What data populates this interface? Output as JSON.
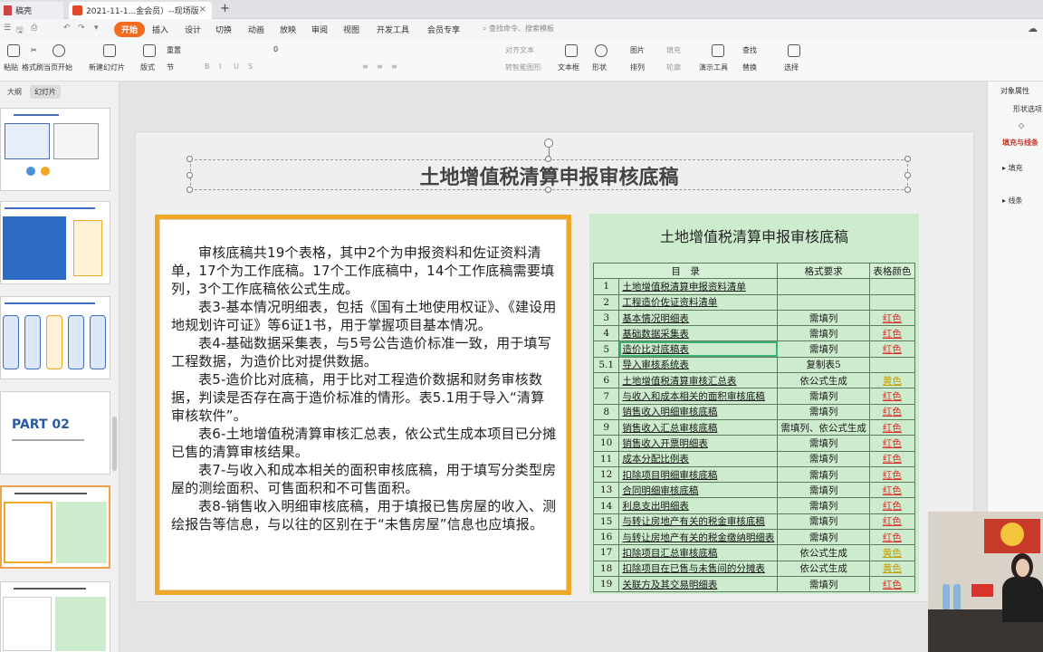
{
  "tabs": [
    {
      "label": "稿壳"
    },
    {
      "label": "2021-11-1...金会员）--现场版"
    }
  ],
  "menu": {
    "items": [
      "开始",
      "插入",
      "设计",
      "切换",
      "动画",
      "放映",
      "审阅",
      "视图",
      "开发工具",
      "会员专享"
    ],
    "search": "查找命令、搜索模板"
  },
  "ribbon": {
    "paste": "粘贴",
    "format_painter": "格式刷",
    "from_current": "当页开始",
    "new_slide": "新建幻灯片",
    "layout": "版式",
    "section": "节",
    "reset": "重置",
    "font_size": "0",
    "align_text": "对齐文本",
    "smart_graphic": "转智能图形",
    "textbox": "文本框",
    "shape": "形状",
    "arrange": "排列",
    "picture": "图片",
    "fill": "填充",
    "outline": "轮廓",
    "present_tools": "演示工具",
    "find": "查找",
    "replace": "替换",
    "select": "选择"
  },
  "leftpane": {
    "outline_tab": "大纲",
    "slides_tab": "幻灯片",
    "part_label": "PART 02"
  },
  "slide": {
    "title": "土地增值税清算申报审核底稿",
    "paragraphs": [
      "审核底稿共19个表格，其中2个为申报资料和佐证资料清单，17个为工作底稿。17个工作底稿中，14个工作底稿需要填列，3个工作底稿依公式生成。",
      "表3-基本情况明细表，包括《国有土地使用权证》、《建设用地规划许可证》等6证1书，用于掌握项目基本情况。",
      "表4-基础数据采集表，与5号公告造价标准一致，用于填写工程数据，为造价比对提供数据。",
      "表5-造价比对底稿，用于比对工程造价数据和财务审核数据，判读是否存在高于造价标准的情形。表5.1用于导入“清算审核软件”。",
      "表6-土地增值税清算审核汇总表，依公式生成本项目已分摊已售的清算审核结果。",
      "表7-与收入和成本相关的面积审核底稿，用于填写分类型房屋的测绘面积、可售面积和不可售面积。",
      "表8-销售收入明细审核底稿，用于填报已售房屋的收入、测绘报告等信息，与以往的区别在于“未售房屋”信息也应填报。"
    ],
    "table_title": "土地增值税清算申报审核底稿",
    "headers": [
      "目　录",
      "格式要求",
      "表格颜色"
    ],
    "rows": [
      {
        "no": "1",
        "name": "土地增值税清算申报资料清单",
        "fmt": "",
        "color": ""
      },
      {
        "no": "2",
        "name": "工程造价佐证资料清单",
        "fmt": "",
        "color": ""
      },
      {
        "no": "3",
        "name": "基本情况明细表",
        "fmt": "需填列",
        "color": "红色"
      },
      {
        "no": "4",
        "name": "基础数据采集表",
        "fmt": "需填列",
        "color": "红色"
      },
      {
        "no": "5",
        "name": "造价比对底稿表",
        "fmt": "需填列",
        "color": "红色"
      },
      {
        "no": "5.1",
        "name": "导入审核系统表",
        "fmt": "复制表5",
        "color": ""
      },
      {
        "no": "6",
        "name": "土地增值税清算审核汇总表",
        "fmt": "依公式生成",
        "color": "黄色"
      },
      {
        "no": "7",
        "name": "与收入和成本相关的面积审核底稿",
        "fmt": "需填列",
        "color": "红色"
      },
      {
        "no": "8",
        "name": "销售收入明细审核底稿",
        "fmt": "需填列",
        "color": "红色"
      },
      {
        "no": "9",
        "name": "销售收入汇总审核底稿",
        "fmt": "需填列、依公式生成",
        "color": "红色"
      },
      {
        "no": "10",
        "name": "销售收入开票明细表",
        "fmt": "需填列",
        "color": "红色"
      },
      {
        "no": "11",
        "name": "成本分配比例表",
        "fmt": "需填列",
        "color": "红色"
      },
      {
        "no": "12",
        "name": "扣除项目明细审核底稿",
        "fmt": "需填列",
        "color": "红色"
      },
      {
        "no": "13",
        "name": "合同明细审核底稿",
        "fmt": "需填列",
        "color": "红色"
      },
      {
        "no": "14",
        "name": "利息支出明细表",
        "fmt": "需填列",
        "color": "红色"
      },
      {
        "no": "15",
        "name": "与转让房地产有关的税金审核底稿",
        "fmt": "需填列",
        "color": "红色"
      },
      {
        "no": "16",
        "name": "与转让房地产有关的税金缴纳明细表",
        "fmt": "需填列",
        "color": "红色"
      },
      {
        "no": "17",
        "name": "扣除项目汇总审核底稿",
        "fmt": "依公式生成",
        "color": "黄色"
      },
      {
        "no": "18",
        "name": "扣除项目在已售与未售间的分摊表",
        "fmt": "依公式生成",
        "color": "黄色"
      },
      {
        "no": "19",
        "name": "关联方及其交易明细表",
        "fmt": "需填列",
        "color": "红色"
      }
    ]
  },
  "rightpane": {
    "object_props": "对象属性",
    "shape_options": "形状选项",
    "fill_and_line": "填充与线条",
    "fill": "填充",
    "line": "线条"
  },
  "colors": {
    "accent": "#f46b1e",
    "textbox_border": "#f0a629",
    "table_bg": "#cdeccd",
    "red": "#e02a2a",
    "yellow": "#c5a000"
  }
}
